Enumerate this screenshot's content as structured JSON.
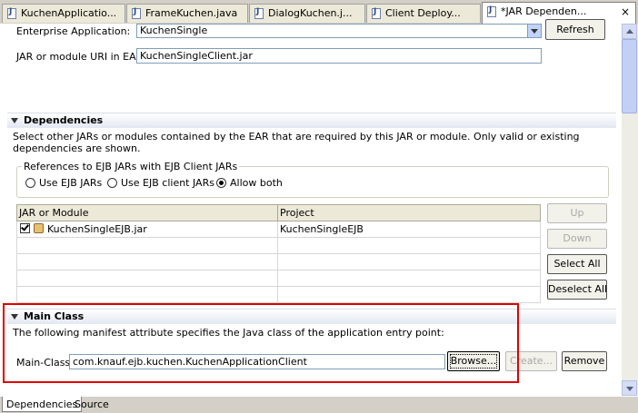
{
  "tabs": [
    {
      "label": "KuchenApplicatio..."
    },
    {
      "label": "FrameKuchen.java"
    },
    {
      "label": "DialogKuchen.j..."
    },
    {
      "label": "Client Deploy..."
    },
    {
      "label": "*JAR Dependen..."
    }
  ],
  "tab_close_glyph": "×",
  "top": {
    "enterprise_app_label": "Enterprise Application:",
    "enterprise_app_value": "KuchenSingle",
    "refresh_label": "Refresh",
    "uri_label": "JAR or module URI in EAR:",
    "uri_value": "KuchenSingleClient.jar"
  },
  "dependencies": {
    "title": "Dependencies",
    "description": "Select other JARs or modules contained by the EAR that are required by this JAR or module.  Only valid or existing dependencies are shown.",
    "group_label": "References to EJB JARs with EJB Client JARs",
    "radios": [
      {
        "label": "Use EJB JARs",
        "selected": false
      },
      {
        "label": "Use EJB client JARs",
        "selected": false
      },
      {
        "label": "Allow both",
        "selected": true
      }
    ],
    "columns": [
      "JAR or Module",
      "Project"
    ],
    "rows": [
      {
        "module": "KuchenSingleEJB.jar",
        "project": "KuchenSingleEJB",
        "checked": true
      }
    ],
    "buttons": {
      "up": "Up",
      "down": "Down",
      "select_all": "Select All",
      "deselect_all": "Deselect All"
    }
  },
  "main_class": {
    "title": "Main Class",
    "description": "The following manifest attribute specifies the Java class of the application entry point:",
    "label": "Main-Class:",
    "value": "com.knauf.ejb.kuchen.KuchenApplicationClient",
    "browse_label": "Browse...",
    "create_label": "Create...",
    "remove_label": "Remove"
  },
  "bottom_tabs": [
    {
      "label": "Dependencies"
    },
    {
      "label": "Source"
    }
  ],
  "colors": {
    "highlight_border": "#e00000",
    "section_header": "#e2e7f2"
  }
}
